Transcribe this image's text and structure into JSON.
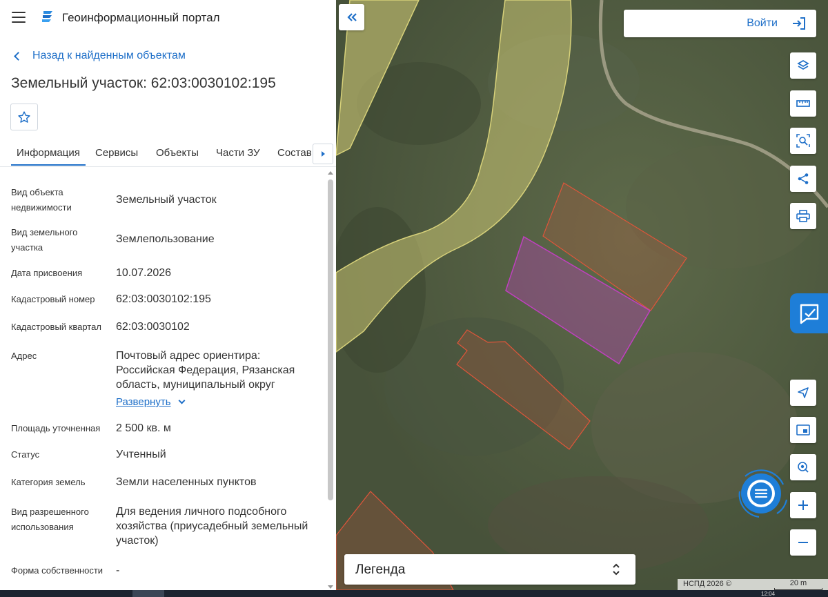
{
  "header": {
    "app_title": "Геоинформационный портал"
  },
  "nav": {
    "back_label": "Назад к найденным объектам"
  },
  "object": {
    "title": "Земельный участок: 62:03:0030102:195"
  },
  "tabs": [
    {
      "label": "Информация",
      "active": true
    },
    {
      "label": "Сервисы",
      "active": false
    },
    {
      "label": "Объекты",
      "active": false
    },
    {
      "label": "Части ЗУ",
      "active": false
    },
    {
      "label": "Состав",
      "active": false
    }
  ],
  "info": {
    "rows": [
      {
        "label": "Вид объекта недвижимости",
        "value": "Земельный участок"
      },
      {
        "label": "Вид земельного участка",
        "value": "Землепользование"
      },
      {
        "label": "Дата присвоения",
        "value": "10.07.2026"
      },
      {
        "label": "Кадастровый номер",
        "value": "62:03:0030102:195"
      },
      {
        "label": "Кадастровый квартал",
        "value": "62:03:0030102"
      },
      {
        "label": "Адрес",
        "value": "Почтовый адрес ориентира: Российская Федерация, Рязанская область, муниципальный округ"
      },
      {
        "label": "Площадь уточненная",
        "value": "2 500 кв. м"
      },
      {
        "label": "Статус",
        "value": "Учтенный"
      },
      {
        "label": "Категория земель",
        "value": "Земли населенных пунктов"
      },
      {
        "label": "Вид разрешенного использования",
        "value": "Для ведения личного подсобного хозяйства (приусадебный земельный участок)"
      },
      {
        "label": "Форма собственности",
        "value": "-"
      }
    ],
    "expand_label": "Развернуть"
  },
  "map": {
    "login_label": "Войти",
    "legend_label": "Легенда",
    "attribution": "НСПД 2026 ©",
    "scale_label": "20 m",
    "colors": {
      "accent": "#1e6fc8",
      "selected_parcel": "#c040c0",
      "parcel_outline": "#e0553a",
      "zone_fill": "#d8d27a"
    }
  },
  "taskbar": {
    "clock": "12:04"
  }
}
